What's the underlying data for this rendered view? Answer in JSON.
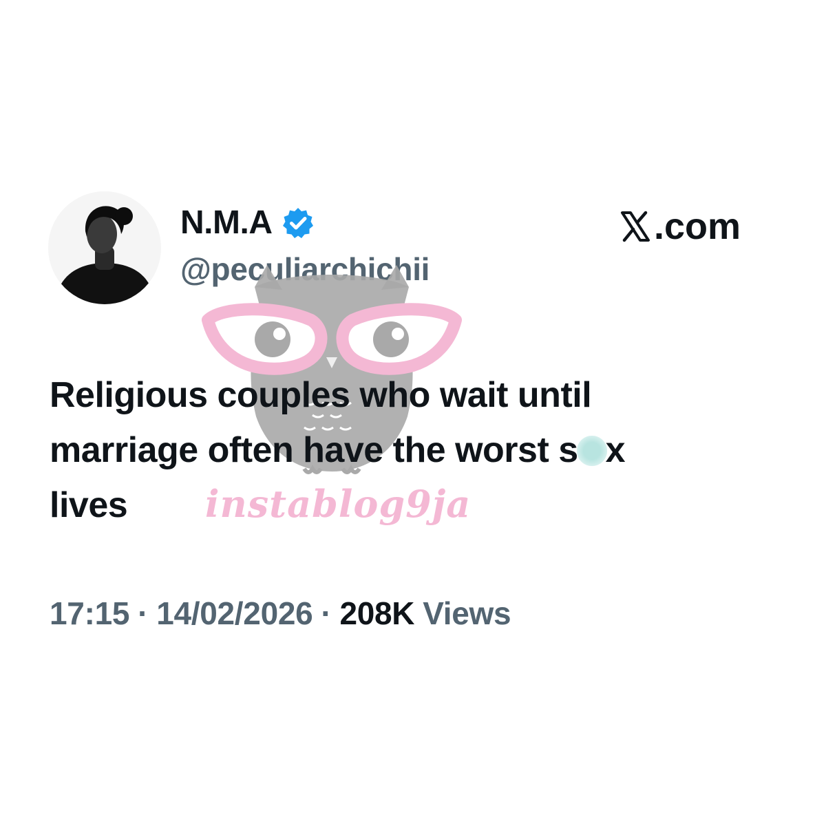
{
  "author": {
    "display_name": "N.M.A",
    "handle": "@peculiarchichii",
    "verified": true
  },
  "brand": {
    "label": ".com",
    "icon": "x-logo-icon"
  },
  "tweet": {
    "lines": [
      {
        "before": "Religious couples who wait until",
        "after": ""
      },
      {
        "before": "marriage often have the worst s",
        "after": "x"
      },
      {
        "before": "lives",
        "after": ""
      }
    ]
  },
  "meta": {
    "time": "17:15",
    "separator": "·",
    "date": "14/02/2026",
    "views_count": "208K",
    "views_label": "Views"
  },
  "watermark": {
    "text": "instablog9ja",
    "icon": "owl-glasses-icon"
  },
  "colors": {
    "text_primary": "#0f1419",
    "text_secondary": "#536471",
    "verified_blue": "#1d9bf0",
    "watermark_pink": "#f4b8d4",
    "watermark_gray": "#a9a9a9"
  }
}
